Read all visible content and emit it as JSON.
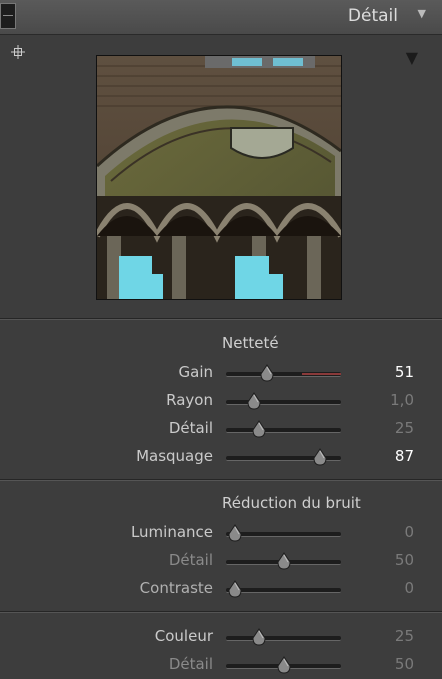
{
  "header": {
    "title": "Détail",
    "collapse_icon": "triangle-down-icon"
  },
  "preview": {
    "target_icon": "crosshair-icon",
    "menu_icon": "triangle-down-icon"
  },
  "sharpening": {
    "title": "Netteté",
    "sliders": [
      {
        "label": "Gain",
        "value": "51",
        "fraction": 0.36,
        "bright": true
      },
      {
        "label": "Rayon",
        "value": "1,0",
        "fraction": 0.24,
        "bright": false
      },
      {
        "label": "Détail",
        "value": "25",
        "fraction": 0.29,
        "bright": false
      },
      {
        "label": "Masquage",
        "value": "87",
        "fraction": 0.82,
        "bright": true
      }
    ]
  },
  "noise": {
    "title": "Réduction du bruit",
    "sliders": [
      {
        "label": "Luminance",
        "value": "0",
        "fraction": 0.08,
        "bright": false
      },
      {
        "label": "Détail",
        "value": "50",
        "fraction": 0.5,
        "bright": false
      },
      {
        "label": "Contraste",
        "value": "0",
        "fraction": 0.08,
        "bright": false
      }
    ],
    "color_sliders": [
      {
        "label": "Couleur",
        "value": "25",
        "fraction": 0.29,
        "bright": false
      },
      {
        "label": "Détail",
        "value": "50",
        "fraction": 0.5,
        "bright": false
      }
    ]
  },
  "colors": {
    "bg": "#3d3d3d",
    "value_bright": "#ffffff",
    "value_dim": "#7a7a7a"
  }
}
